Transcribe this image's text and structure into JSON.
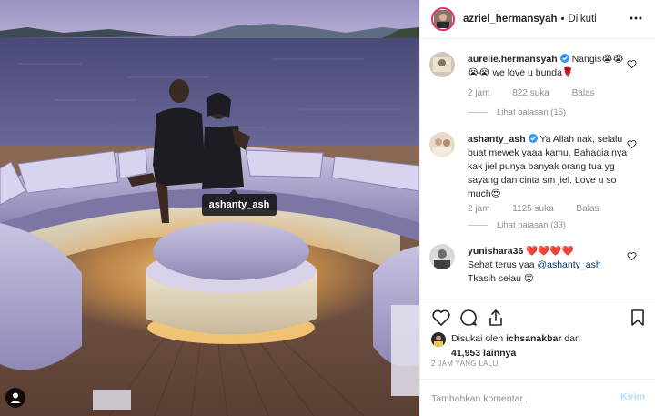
{
  "post": {
    "photo_alt": "",
    "photo_tag": "ashanty_ash"
  },
  "header": {
    "username": "azriel_hermansyah",
    "separator": "•",
    "follow_state": "Diikuti"
  },
  "comments": [
    {
      "author": "aurelie.hermansyah",
      "verified": true,
      "text": "Nangis😭😭😭😭 we love u bunda🌹",
      "time": "2 jam",
      "likes": "822 suka",
      "reply_label": "Balas",
      "view_replies": "Lihat balasan (15)"
    },
    {
      "author": "ashanty_ash",
      "verified": true,
      "text": "Ya Allah nak, selalu buat mewek yaaa kamu. Bahagia nya kak jiel punya banyak orang tua yg sayang dan cinta sm jiel. Love u so much😍",
      "time": "2 jam",
      "likes": "1125 suka",
      "reply_label": "Balas",
      "view_replies": "Lihat balasan (33)"
    },
    {
      "author": "yunishara36",
      "verified": false,
      "hearts": "❤️❤️❤️❤️",
      "text_before": "Sehat terus yaa ",
      "mention": "@ashanty_ash",
      "text_after": " Tkasih selau 😊"
    }
  ],
  "actions": {
    "like_icon": "heart-outline-icon",
    "comment_icon": "comment-bubble-icon",
    "share_icon": "share-upload-icon",
    "save_icon": "bookmark-icon"
  },
  "likes": {
    "prefix": "Disukai oleh ",
    "user": "ichsanakbar",
    "middle": " dan",
    "count": "41,953",
    "suffix": " lainnya"
  },
  "timestamp": "2 JAM YANG LALU",
  "comment_input": {
    "placeholder": "Tambahkan komentar...",
    "send_label": "Kirim"
  },
  "colors": {
    "link": "#003569",
    "muted": "#8e8e8e",
    "send_disabled": "#b2dffc",
    "story_ring": "#e1306c",
    "verified": "#3897f0"
  }
}
